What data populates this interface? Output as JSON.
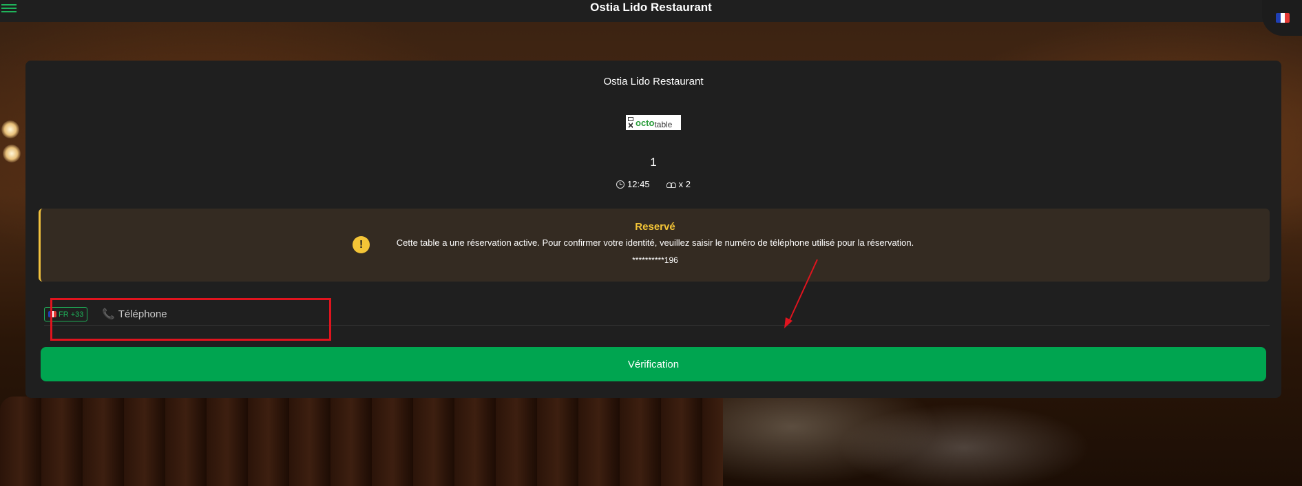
{
  "header": {
    "title": "Ostia Lido Restaurant",
    "menu_icon": "hamburger-menu-icon",
    "language_flag": "france-flag-icon"
  },
  "card": {
    "restaurant_name": "Ostia Lido Restaurant",
    "logo": {
      "octo": "octo",
      "table": "table"
    },
    "table_number": "1",
    "time": "12:45",
    "guests": "x 2"
  },
  "alert": {
    "title": "Reservé",
    "message": "Cette table a une réservation active. Pour confirmer votre identité, veuillez saisir le numéro de téléphone utilisé pour la réservation.",
    "masked_phone": "**********196",
    "icon": "!"
  },
  "phone": {
    "country_label": "FR +33",
    "placeholder": "Téléphone",
    "value": ""
  },
  "verify_button": "Vérification",
  "colors": {
    "accent": "#00a550",
    "warning": "#f4c537",
    "annotation": "#e0141e"
  }
}
